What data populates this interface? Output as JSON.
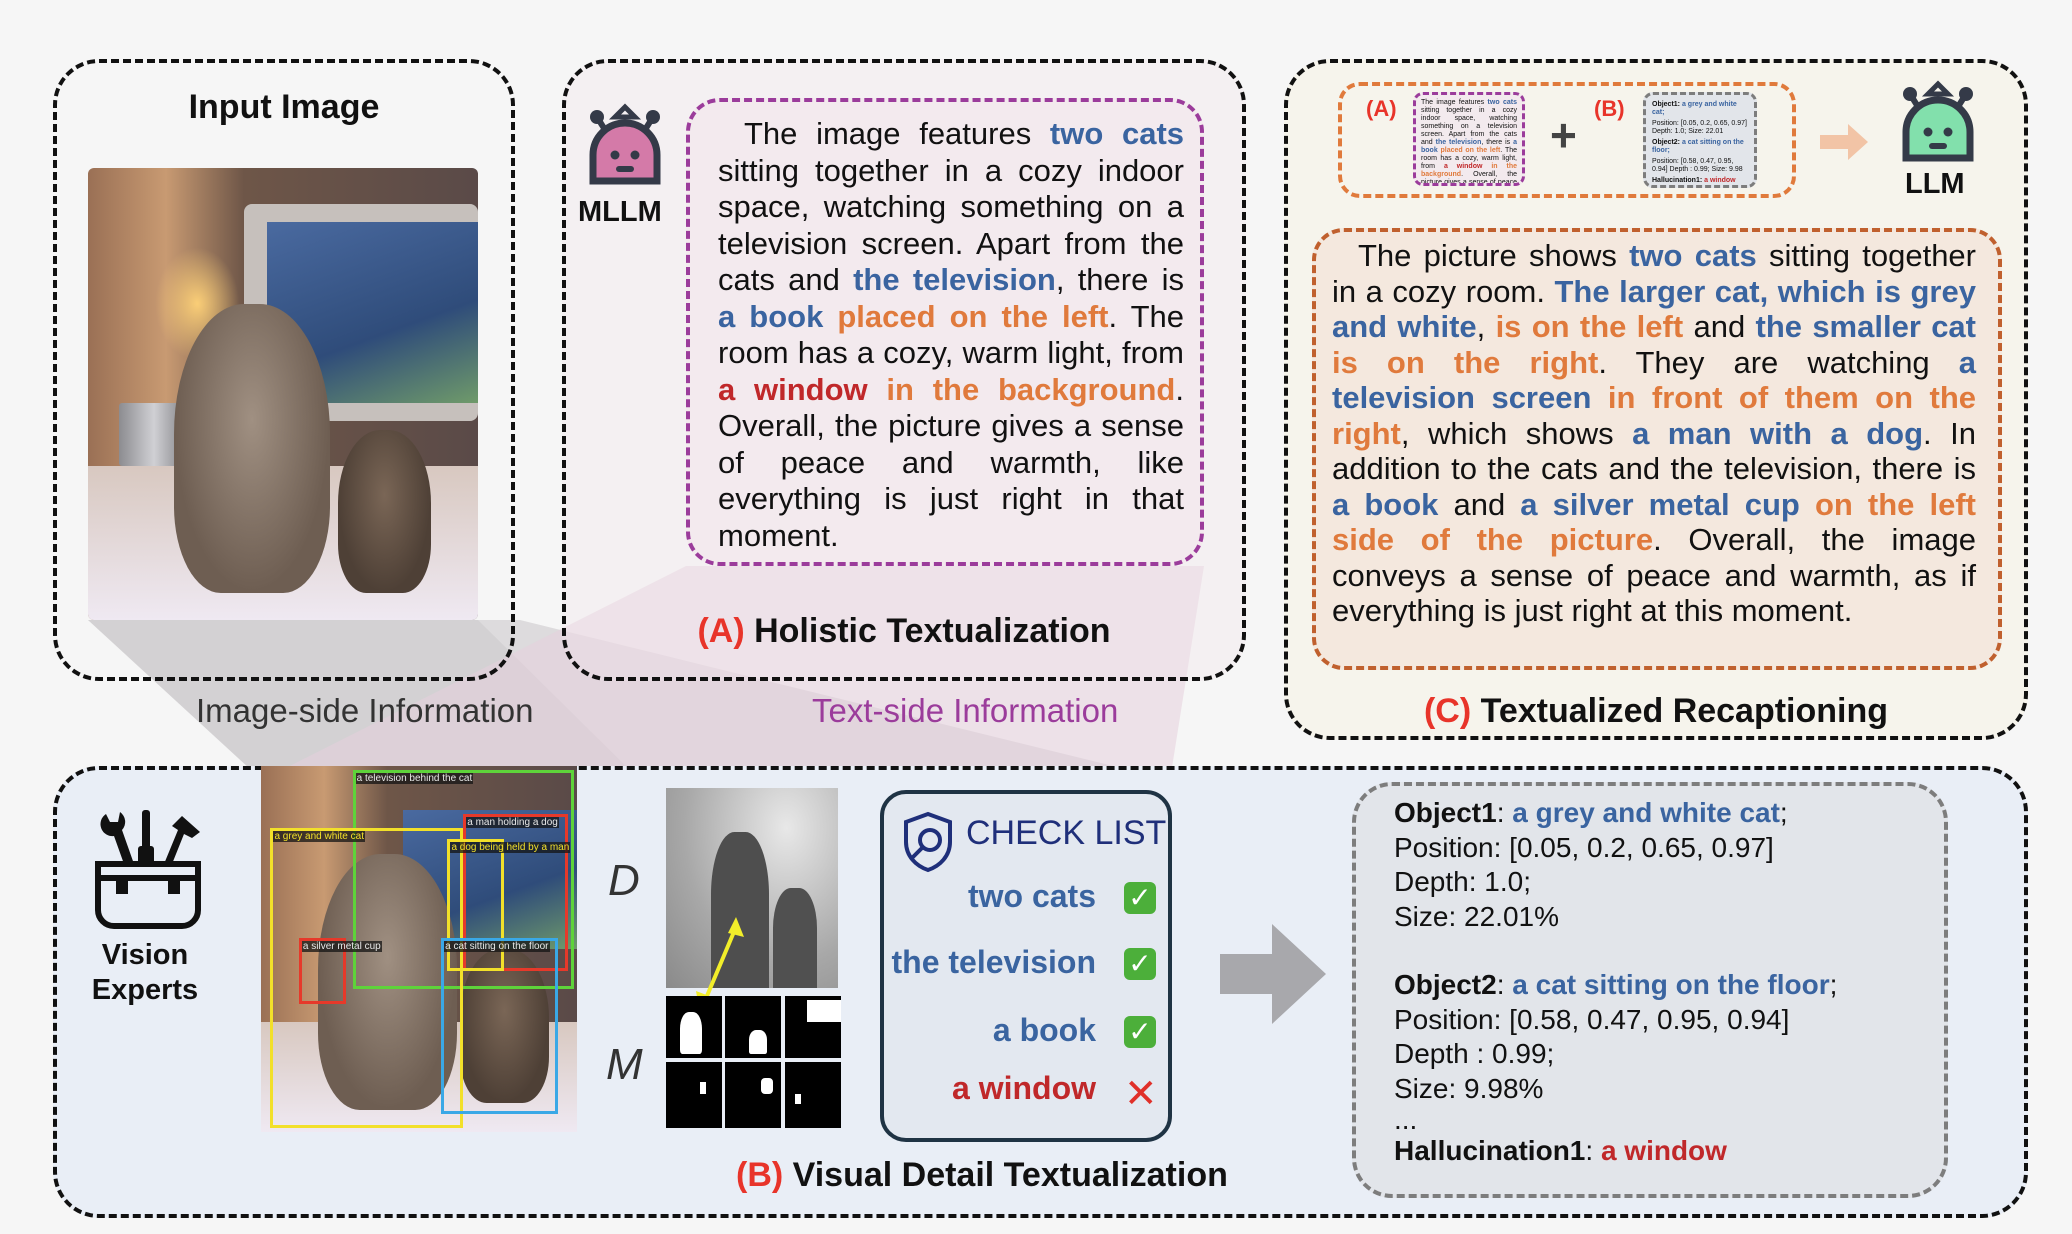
{
  "input_panel": {
    "title": "Input Image"
  },
  "panel_a": {
    "model_label": "MLLM",
    "caption_prefix": "(A)",
    "caption": "Holistic Textualization",
    "text_segments": [
      {
        "t": "The image features ",
        "c": "plain"
      },
      {
        "t": "two cats",
        "c": "blue"
      },
      {
        "t": " sitting together in a cozy indoor space, watching something on a television screen. Apart from the cats and ",
        "c": "plain"
      },
      {
        "t": "the television",
        "c": "blue"
      },
      {
        "t": ", there is ",
        "c": "plain"
      },
      {
        "t": "a book",
        "c": "blue"
      },
      {
        "t": " ",
        "c": "plain"
      },
      {
        "t": "placed on the left",
        "c": "orange"
      },
      {
        "t": ". The room has a cozy, warm light, from ",
        "c": "plain"
      },
      {
        "t": "a window",
        "c": "red"
      },
      {
        "t": " ",
        "c": "plain"
      },
      {
        "t": "in the background",
        "c": "orange"
      },
      {
        "t": ". Overall, the picture gives a sense of peace and warmth, like everything is just right in that moment.",
        "c": "plain"
      }
    ]
  },
  "panel_c": {
    "model_label": "LLM",
    "caption_prefix": "(C)",
    "caption": "Textualized Recaptioning",
    "input_a_label": "(A)",
    "input_b_label": "(B)",
    "plus_symbol": "+",
    "mini_b_lines": [
      {
        "k": "Object1",
        "v": "a grey and white cat;"
      },
      {
        "k": "",
        "v": "Position: [0.05, 0.2, 0.65, 0.97] Depth: 1.0; Size: 22.01"
      },
      {
        "k": "Object2",
        "v": "a cat sitting on the floor;"
      },
      {
        "k": "",
        "v": "Position: [0.58, 0.47, 0.95, 0.94] Depth : 0.99; Size: 9.98"
      },
      {
        "k": "Hallucination1",
        "v": "a window"
      }
    ],
    "text_segments": [
      {
        "t": "The picture shows ",
        "c": "plain"
      },
      {
        "t": "two cats",
        "c": "blue"
      },
      {
        "t": " sitting together in a cozy room. ",
        "c": "plain"
      },
      {
        "t": "The larger cat, which is grey and white",
        "c": "blue"
      },
      {
        "t": ", ",
        "c": "plain"
      },
      {
        "t": "is on the left",
        "c": "orange"
      },
      {
        "t": " and ",
        "c": "plain"
      },
      {
        "t": "the smaller cat",
        "c": "blue"
      },
      {
        "t": " ",
        "c": "plain"
      },
      {
        "t": "is on the right",
        "c": "orange"
      },
      {
        "t": ". They are watching ",
        "c": "plain"
      },
      {
        "t": "a television screen",
        "c": "blue"
      },
      {
        "t": " ",
        "c": "plain"
      },
      {
        "t": "in front of them on the right",
        "c": "orange"
      },
      {
        "t": ", which shows ",
        "c": "plain"
      },
      {
        "t": "a man with a dog",
        "c": "blue"
      },
      {
        "t": ". In addition to the cats and the television, there is ",
        "c": "plain"
      },
      {
        "t": "a book",
        "c": "blue"
      },
      {
        "t": " and ",
        "c": "plain"
      },
      {
        "t": "a silver metal cup",
        "c": "blue"
      },
      {
        "t": " ",
        "c": "plain"
      },
      {
        "t": "on the left side of the picture",
        "c": "orange"
      },
      {
        "t": ". Overall, the image conveys a sense of peace and warmth, as if everything is just right at this moment.",
        "c": "plain"
      }
    ]
  },
  "labels": {
    "image_side": "Image-side Information",
    "text_side": "Text-side Information"
  },
  "panel_b": {
    "experts_label_1": "Vision",
    "experts_label_2": "Experts",
    "caption_prefix": "(B)",
    "caption": "Visual Detail Textualization",
    "depth_label": "D",
    "mask_label": "M",
    "detections": [
      {
        "label": "a television behind the cat",
        "color": "#5ed33a"
      },
      {
        "label": "a grey and white cat",
        "color": "#f2e02a"
      },
      {
        "label": "a man holding a dog",
        "color": "#e6392a"
      },
      {
        "label": "a dog being held by a man",
        "color": "#f2e02a"
      },
      {
        "label": "a silver metal cup",
        "color": "#e6392a"
      },
      {
        "label": "a cat sitting on the floor",
        "color": "#3aa8e6"
      }
    ],
    "checklist": {
      "title": "CHECK LIST",
      "items": [
        {
          "label": "two cats",
          "status": "verified",
          "mark": "✓"
        },
        {
          "label": "the television",
          "status": "verified",
          "mark": "✓"
        },
        {
          "label": "a book",
          "status": "verified",
          "mark": "✓"
        },
        {
          "label": "a window",
          "status": "hallucinated",
          "mark": "✕"
        }
      ]
    },
    "objects": {
      "obj1_key": "Object1",
      "obj1_val": "a grey and white cat",
      "obj1_position": "Position: [0.05, 0.2, 0.65, 0.97]",
      "obj1_depth": "Depth: 1.0;",
      "obj1_size": "Size: 22.01%",
      "obj2_key": "Object2",
      "obj2_val": "a cat sitting on the floor",
      "obj2_position": "Position: [0.58, 0.47, 0.95, 0.94]",
      "obj2_depth": "Depth : 0.99;",
      "obj2_size": "Size: 9.98%",
      "ellipsis": "...",
      "hall_key": "Hallucination1",
      "hall_val": "a window"
    }
  },
  "colors": {
    "entity_blue": "#3a64a0",
    "position_orange": "#e07a3c",
    "hallucination_red": "#c0282a",
    "label_red": "#e8342a",
    "text_side_purple": "#9b3c9b",
    "mllm_pink": "#d47aa8",
    "llm_green": "#82e0ac"
  }
}
